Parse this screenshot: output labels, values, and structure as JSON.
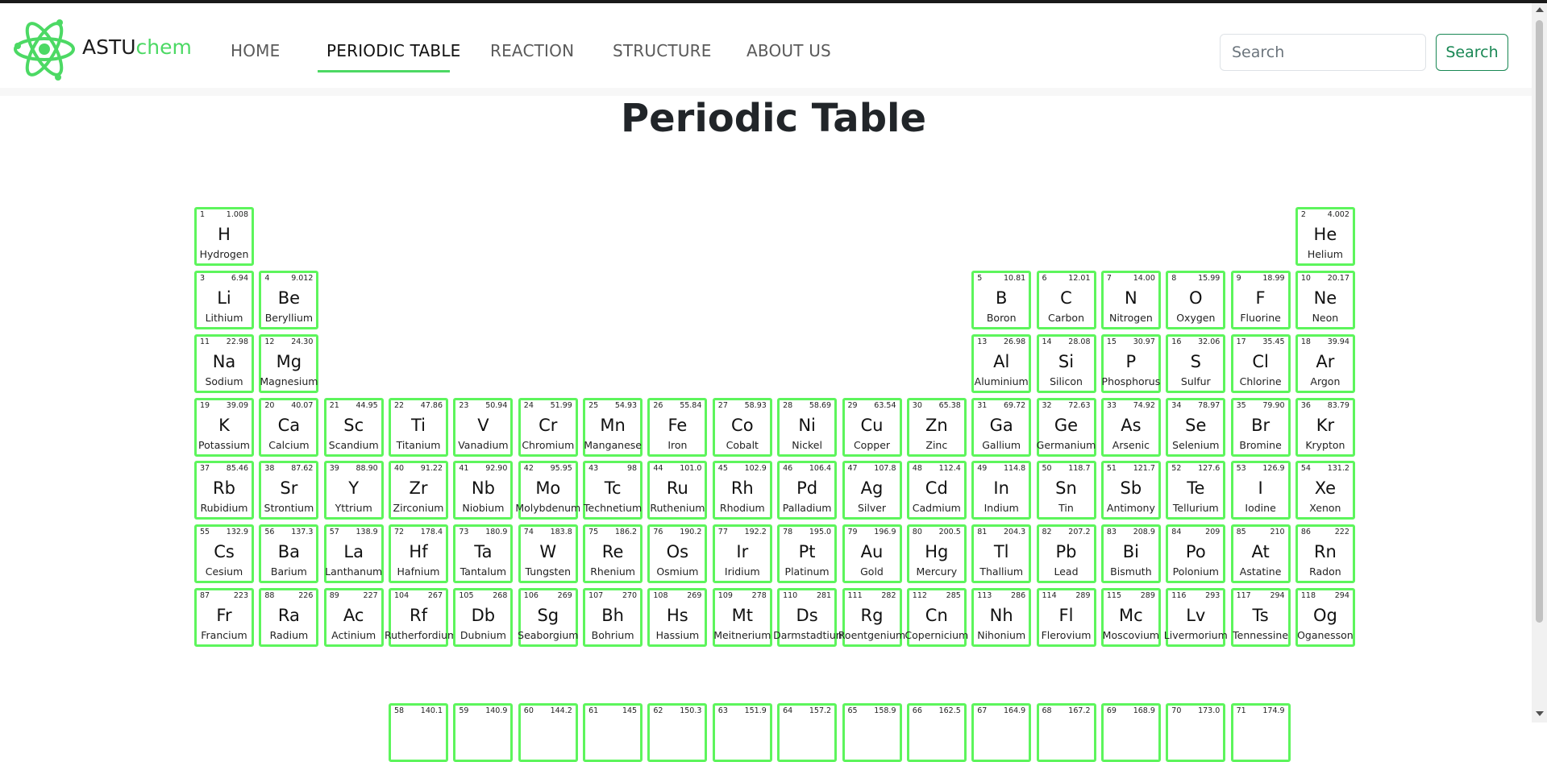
{
  "brand": {
    "part1": "ASTU",
    "part2": "chem",
    "logo_icon": "atom-icon"
  },
  "nav": [
    {
      "label": "HOME",
      "active": false
    },
    {
      "label": "PERIODIC TABLE",
      "active": true
    },
    {
      "label": "REACTION",
      "active": false
    },
    {
      "label": "STRUCTURE",
      "active": false
    },
    {
      "label": "ABOUT US",
      "active": false
    }
  ],
  "search": {
    "placeholder": "Search",
    "value": "",
    "button_label": "Search"
  },
  "page_title": "Periodic Table",
  "colors": {
    "accent": "#4cd964",
    "cell_border": "#5df55c",
    "search_button": "#198754"
  },
  "elements": [
    {
      "num": "1",
      "mass": "1.008",
      "sym": "H",
      "name": "Hydrogen"
    },
    {
      "num": "2",
      "mass": "4.002",
      "sym": "He",
      "name": "Helium"
    },
    {
      "num": "3",
      "mass": "6.94",
      "sym": "Li",
      "name": "Lithium"
    },
    {
      "num": "4",
      "mass": "9.012",
      "sym": "Be",
      "name": "Beryllium"
    },
    {
      "num": "5",
      "mass": "10.81",
      "sym": "B",
      "name": "Boron"
    },
    {
      "num": "6",
      "mass": "12.01",
      "sym": "C",
      "name": "Carbon"
    },
    {
      "num": "7",
      "mass": "14.00",
      "sym": "N",
      "name": "Nitrogen"
    },
    {
      "num": "8",
      "mass": "15.99",
      "sym": "O",
      "name": "Oxygen"
    },
    {
      "num": "9",
      "mass": "18.99",
      "sym": "F",
      "name": "Fluorine"
    },
    {
      "num": "10",
      "mass": "20.17",
      "sym": "Ne",
      "name": "Neon"
    },
    {
      "num": "11",
      "mass": "22.98",
      "sym": "Na",
      "name": "Sodium"
    },
    {
      "num": "12",
      "mass": "24.30",
      "sym": "Mg",
      "name": "Magnesium"
    },
    {
      "num": "13",
      "mass": "26.98",
      "sym": "Al",
      "name": "Aluminium"
    },
    {
      "num": "14",
      "mass": "28.08",
      "sym": "Si",
      "name": "Silicon"
    },
    {
      "num": "15",
      "mass": "30.97",
      "sym": "P",
      "name": "Phosphorus"
    },
    {
      "num": "16",
      "mass": "32.06",
      "sym": "S",
      "name": "Sulfur"
    },
    {
      "num": "17",
      "mass": "35.45",
      "sym": "Cl",
      "name": "Chlorine"
    },
    {
      "num": "18",
      "mass": "39.94",
      "sym": "Ar",
      "name": "Argon"
    },
    {
      "num": "19",
      "mass": "39.09",
      "sym": "K",
      "name": "Potassium"
    },
    {
      "num": "20",
      "mass": "40.07",
      "sym": "Ca",
      "name": "Calcium"
    },
    {
      "num": "21",
      "mass": "44.95",
      "sym": "Sc",
      "name": "Scandium"
    },
    {
      "num": "22",
      "mass": "47.86",
      "sym": "Ti",
      "name": "Titanium"
    },
    {
      "num": "23",
      "mass": "50.94",
      "sym": "V",
      "name": "Vanadium"
    },
    {
      "num": "24",
      "mass": "51.99",
      "sym": "Cr",
      "name": "Chromium"
    },
    {
      "num": "25",
      "mass": "54.93",
      "sym": "Mn",
      "name": "Manganese"
    },
    {
      "num": "26",
      "mass": "55.84",
      "sym": "Fe",
      "name": "Iron"
    },
    {
      "num": "27",
      "mass": "58.93",
      "sym": "Co",
      "name": "Cobalt"
    },
    {
      "num": "28",
      "mass": "58.69",
      "sym": "Ni",
      "name": "Nickel"
    },
    {
      "num": "29",
      "mass": "63.54",
      "sym": "Cu",
      "name": "Copper"
    },
    {
      "num": "30",
      "mass": "65.38",
      "sym": "Zn",
      "name": "Zinc"
    },
    {
      "num": "31",
      "mass": "69.72",
      "sym": "Ga",
      "name": "Gallium"
    },
    {
      "num": "32",
      "mass": "72.63",
      "sym": "Ge",
      "name": "Germanium"
    },
    {
      "num": "33",
      "mass": "74.92",
      "sym": "As",
      "name": "Arsenic"
    },
    {
      "num": "34",
      "mass": "78.97",
      "sym": "Se",
      "name": "Selenium"
    },
    {
      "num": "35",
      "mass": "79.90",
      "sym": "Br",
      "name": "Bromine"
    },
    {
      "num": "36",
      "mass": "83.79",
      "sym": "Kr",
      "name": "Krypton"
    },
    {
      "num": "37",
      "mass": "85.46",
      "sym": "Rb",
      "name": "Rubidium"
    },
    {
      "num": "38",
      "mass": "87.62",
      "sym": "Sr",
      "name": "Strontium"
    },
    {
      "num": "39",
      "mass": "88.90",
      "sym": "Y",
      "name": "Yttrium"
    },
    {
      "num": "40",
      "mass": "91.22",
      "sym": "Zr",
      "name": "Zirconium"
    },
    {
      "num": "41",
      "mass": "92.90",
      "sym": "Nb",
      "name": "Niobium"
    },
    {
      "num": "42",
      "mass": "95.95",
      "sym": "Mo",
      "name": "Molybdenum"
    },
    {
      "num": "43",
      "mass": "98",
      "sym": "Tc",
      "name": "Technetium"
    },
    {
      "num": "44",
      "mass": "101.0",
      "sym": "Ru",
      "name": "Ruthenium"
    },
    {
      "num": "45",
      "mass": "102.9",
      "sym": "Rh",
      "name": "Rhodium"
    },
    {
      "num": "46",
      "mass": "106.4",
      "sym": "Pd",
      "name": "Palladium"
    },
    {
      "num": "47",
      "mass": "107.8",
      "sym": "Ag",
      "name": "Silver"
    },
    {
      "num": "48",
      "mass": "112.4",
      "sym": "Cd",
      "name": "Cadmium"
    },
    {
      "num": "49",
      "mass": "114.8",
      "sym": "In",
      "name": "Indium"
    },
    {
      "num": "50",
      "mass": "118.7",
      "sym": "Sn",
      "name": "Tin"
    },
    {
      "num": "51",
      "mass": "121.7",
      "sym": "Sb",
      "name": "Antimony"
    },
    {
      "num": "52",
      "mass": "127.6",
      "sym": "Te",
      "name": "Tellurium"
    },
    {
      "num": "53",
      "mass": "126.9",
      "sym": "I",
      "name": "Iodine"
    },
    {
      "num": "54",
      "mass": "131.2",
      "sym": "Xe",
      "name": "Xenon"
    },
    {
      "num": "55",
      "mass": "132.9",
      "sym": "Cs",
      "name": "Cesium"
    },
    {
      "num": "56",
      "mass": "137.3",
      "sym": "Ba",
      "name": "Barium"
    },
    {
      "num": "57",
      "mass": "138.9",
      "sym": "La",
      "name": "Lanthanum"
    },
    {
      "num": "72",
      "mass": "178.4",
      "sym": "Hf",
      "name": "Hafnium"
    },
    {
      "num": "73",
      "mass": "180.9",
      "sym": "Ta",
      "name": "Tantalum"
    },
    {
      "num": "74",
      "mass": "183.8",
      "sym": "W",
      "name": "Tungsten"
    },
    {
      "num": "75",
      "mass": "186.2",
      "sym": "Re",
      "name": "Rhenium"
    },
    {
      "num": "76",
      "mass": "190.2",
      "sym": "Os",
      "name": "Osmium"
    },
    {
      "num": "77",
      "mass": "192.2",
      "sym": "Ir",
      "name": "Iridium"
    },
    {
      "num": "78",
      "mass": "195.0",
      "sym": "Pt",
      "name": "Platinum"
    },
    {
      "num": "79",
      "mass": "196.9",
      "sym": "Au",
      "name": "Gold"
    },
    {
      "num": "80",
      "mass": "200.5",
      "sym": "Hg",
      "name": "Mercury"
    },
    {
      "num": "81",
      "mass": "204.3",
      "sym": "Tl",
      "name": "Thallium"
    },
    {
      "num": "82",
      "mass": "207.2",
      "sym": "Pb",
      "name": "Lead"
    },
    {
      "num": "83",
      "mass": "208.9",
      "sym": "Bi",
      "name": "Bismuth"
    },
    {
      "num": "84",
      "mass": "209",
      "sym": "Po",
      "name": "Polonium"
    },
    {
      "num": "85",
      "mass": "210",
      "sym": "At",
      "name": "Astatine"
    },
    {
      "num": "86",
      "mass": "222",
      "sym": "Rn",
      "name": "Radon"
    },
    {
      "num": "87",
      "mass": "223",
      "sym": "Fr",
      "name": "Francium"
    },
    {
      "num": "88",
      "mass": "226",
      "sym": "Ra",
      "name": "Radium"
    },
    {
      "num": "89",
      "mass": "227",
      "sym": "Ac",
      "name": "Actinium"
    },
    {
      "num": "104",
      "mass": "267",
      "sym": "Rf",
      "name": "Rutherfordium"
    },
    {
      "num": "105",
      "mass": "268",
      "sym": "Db",
      "name": "Dubnium"
    },
    {
      "num": "106",
      "mass": "269",
      "sym": "Sg",
      "name": "Seaborgium"
    },
    {
      "num": "107",
      "mass": "270",
      "sym": "Bh",
      "name": "Bohrium"
    },
    {
      "num": "108",
      "mass": "269",
      "sym": "Hs",
      "name": "Hassium"
    },
    {
      "num": "109",
      "mass": "278",
      "sym": "Mt",
      "name": "Meitnerium"
    },
    {
      "num": "110",
      "mass": "281",
      "sym": "Ds",
      "name": "Darmstadtium"
    },
    {
      "num": "111",
      "mass": "282",
      "sym": "Rg",
      "name": "Roentgenium"
    },
    {
      "num": "112",
      "mass": "285",
      "sym": "Cn",
      "name": "Copernicium"
    },
    {
      "num": "113",
      "mass": "286",
      "sym": "Nh",
      "name": "Nihonium"
    },
    {
      "num": "114",
      "mass": "289",
      "sym": "Fl",
      "name": "Flerovium"
    },
    {
      "num": "115",
      "mass": "289",
      "sym": "Mc",
      "name": "Moscovium"
    },
    {
      "num": "116",
      "mass": "293",
      "sym": "Lv",
      "name": "Livermorium"
    },
    {
      "num": "117",
      "mass": "294",
      "sym": "Ts",
      "name": "Tennessine"
    },
    {
      "num": "118",
      "mass": "294",
      "sym": "Og",
      "name": "Oganesson"
    },
    {
      "num": "58",
      "mass": "140.1",
      "sym": "",
      "name": ""
    },
    {
      "num": "59",
      "mass": "140.9",
      "sym": "",
      "name": ""
    },
    {
      "num": "60",
      "mass": "144.2",
      "sym": "",
      "name": ""
    },
    {
      "num": "61",
      "mass": "145",
      "sym": "",
      "name": ""
    },
    {
      "num": "62",
      "mass": "150.3",
      "sym": "",
      "name": ""
    },
    {
      "num": "63",
      "mass": "151.9",
      "sym": "",
      "name": ""
    },
    {
      "num": "64",
      "mass": "157.2",
      "sym": "",
      "name": ""
    },
    {
      "num": "65",
      "mass": "158.9",
      "sym": "",
      "name": ""
    },
    {
      "num": "66",
      "mass": "162.5",
      "sym": "",
      "name": ""
    },
    {
      "num": "67",
      "mass": "164.9",
      "sym": "",
      "name": ""
    },
    {
      "num": "68",
      "mass": "167.2",
      "sym": "",
      "name": ""
    },
    {
      "num": "69",
      "mass": "168.9",
      "sym": "",
      "name": ""
    },
    {
      "num": "70",
      "mass": "173.0",
      "sym": "",
      "name": ""
    },
    {
      "num": "71",
      "mass": "174.9",
      "sym": "",
      "name": ""
    }
  ]
}
